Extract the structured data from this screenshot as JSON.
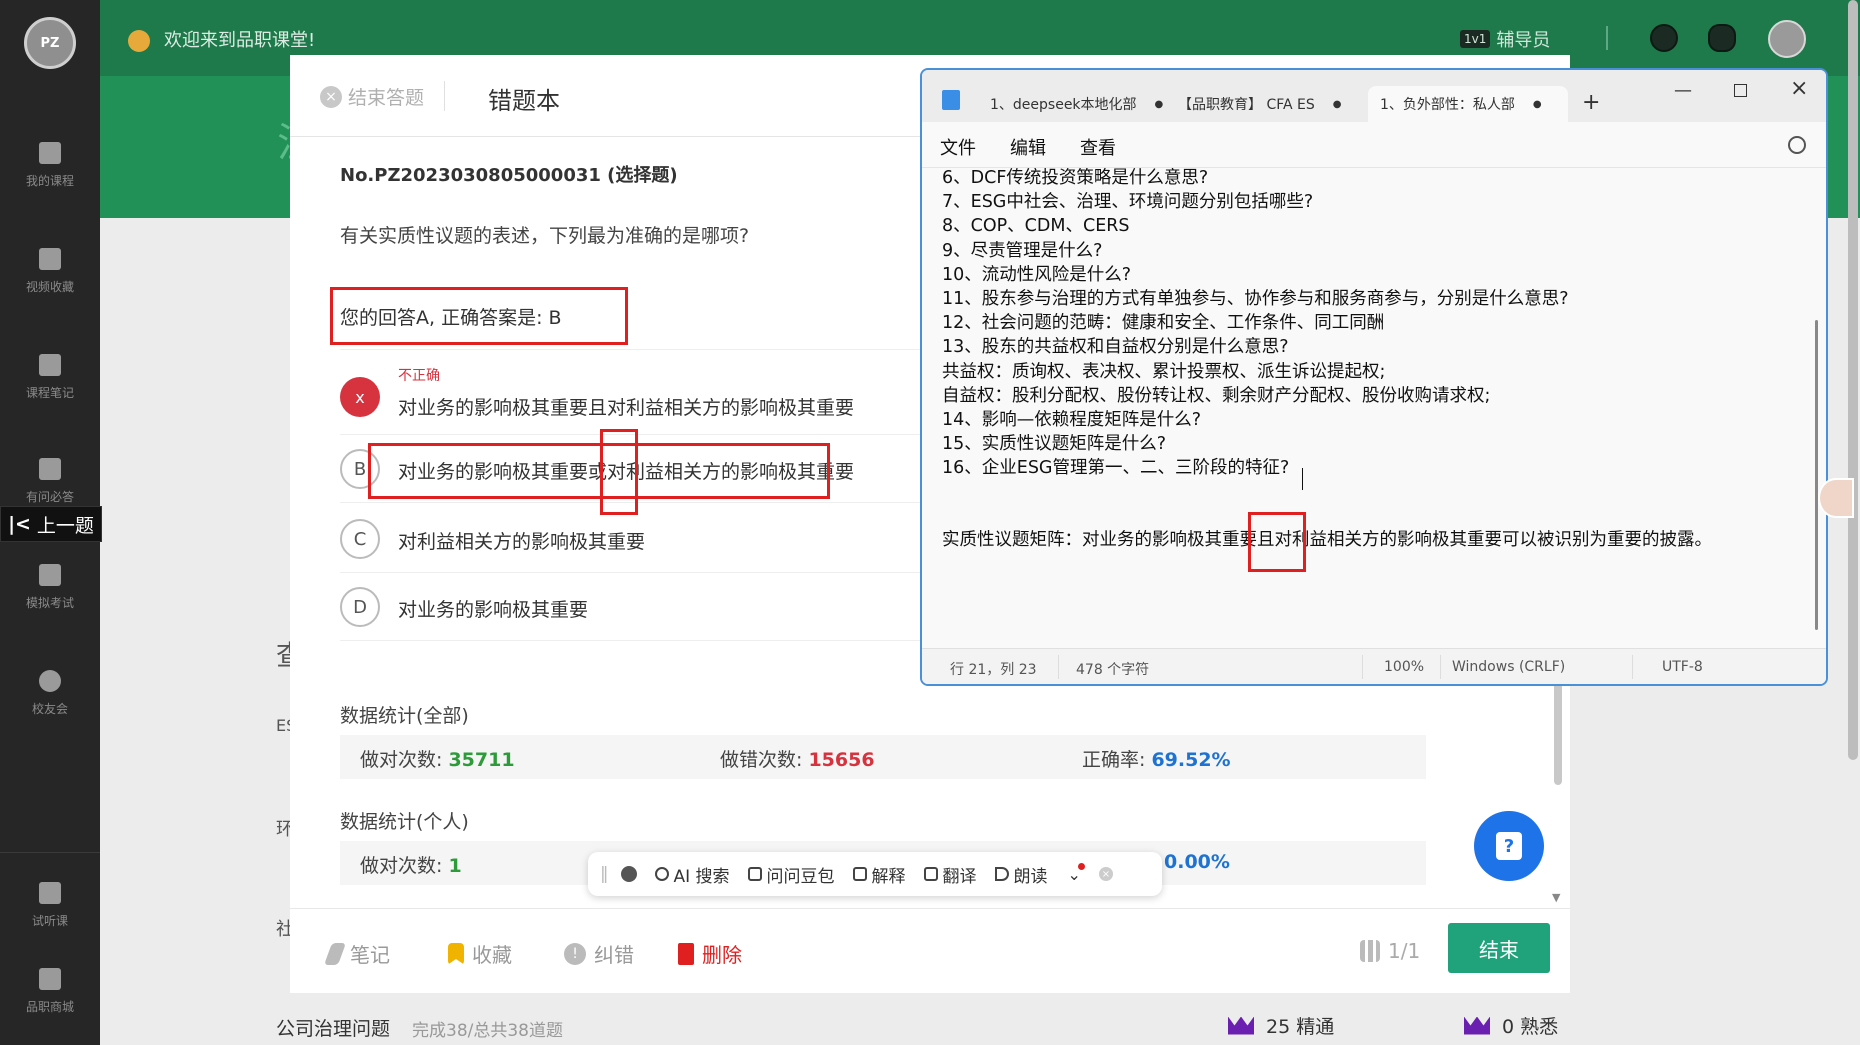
{
  "sidebar": {
    "logo_text": "PZ",
    "items": [
      {
        "label": "我的课程",
        "icon": "course-icon"
      },
      {
        "label": "视频收藏",
        "icon": "bookmark-icon"
      },
      {
        "label": "课程笔记",
        "icon": "note-icon"
      },
      {
        "label": "有问必答",
        "icon": "chat-icon"
      },
      {
        "label": "模拟考试",
        "icon": "flag-icon"
      },
      {
        "label": "校友会",
        "icon": "smile-icon"
      },
      {
        "label": "试听课",
        "icon": "monitor-icon"
      },
      {
        "label": "品职商城",
        "icon": "box-icon"
      }
    ],
    "prev_label": "上一题"
  },
  "topbar": {
    "welcome": "欢迎来到品职课堂!",
    "tutor_badge": "1v1",
    "tutor_label": "辅导员"
  },
  "modal": {
    "end_label": "结束答题",
    "title": "错题本",
    "question_id": "No.PZ2023030805000031 (选择题)",
    "question": "有关实质性议题的表述，下列最为准确的是哪项?",
    "answer_line": "您的回答A, 正确答案是: B",
    "options": [
      {
        "letter": "x",
        "status": "不正确",
        "text": "对业务的影响极其重要且对利益相关方的影响极其重要"
      },
      {
        "letter": "B",
        "status": "",
        "text": "对业务的影响极其重要或对利益相关方的影响极其重要"
      },
      {
        "letter": "C",
        "status": "",
        "text": "对利益相关方的影响极其重要"
      },
      {
        "letter": "D",
        "status": "",
        "text": "对业务的影响极其重要"
      }
    ],
    "stats_all": {
      "title": "数据统计(全部)",
      "correct_label": "做对次数: ",
      "correct_value": "35711",
      "wrong_label": "做错次数: ",
      "wrong_value": "15656",
      "rate_label": "正确率: ",
      "rate_value": "69.52%"
    },
    "stats_personal": {
      "title": "数据统计(个人)",
      "correct_label": "做对次数: ",
      "correct_value": "1",
      "rate_value": "0.00%"
    },
    "footer": {
      "note": "笔记",
      "fav": "收藏",
      "report": "纠错",
      "delete": "删除",
      "page": "1/1",
      "end": "结束"
    }
  },
  "behind": {
    "bottom_left": "公司治理问题",
    "bottom_progress": "完成38/总共38道题",
    "mastered": "25 精通",
    "familiar": "0 熟悉",
    "partial_left": [
      "查",
      "ES",
      "环",
      "社"
    ]
  },
  "notepad": {
    "tabs": [
      "1、deepseek本地化部",
      "【品职教育】 CFA ES",
      "1、负外部性：私人部"
    ],
    "menu": [
      "文件",
      "编辑",
      "查看"
    ],
    "lines": [
      "6、DCF传统投资策略是什么意思?",
      "7、ESG中社会、治理、环境问题分别包括哪些?",
      "8、COP、CDM、CERS",
      "9、尽责管理是什么?",
      "10、流动性风险是什么?",
      "11、股东参与治理的方式有单独参与、协作参与和服务商参与，分别是什么意思?",
      "12、社会问题的范畴：健康和安全、工作条件、同工同酬",
      "13、股东的共益权和自益权分别是什么意思?",
      "共益权：质询权、表决权、累计投票权、派生诉讼提起权;",
      "自益权：股利分配权、股份转让权、剩余财产分配权、股份收购请求权;",
      "14、影响—依赖程度矩阵是什么?",
      "15、实质性议题矩阵是什么?",
      "16、企业ESG管理第一、二、三阶段的特征?"
    ],
    "matrix_line": "实质性议题矩阵：对业务的影响极其重要且对利益相关方的影响极其重要可以被识别为重要的披露。",
    "status": {
      "position": "行 21，列 23",
      "chars": "478 个字符",
      "zoom": "100%",
      "eol": "Windows (CRLF)",
      "encoding": "UTF-8"
    }
  },
  "floatbar": {
    "items": [
      "AI 搜索",
      "问问豆包",
      "解释",
      "翻译",
      "朗读"
    ]
  }
}
